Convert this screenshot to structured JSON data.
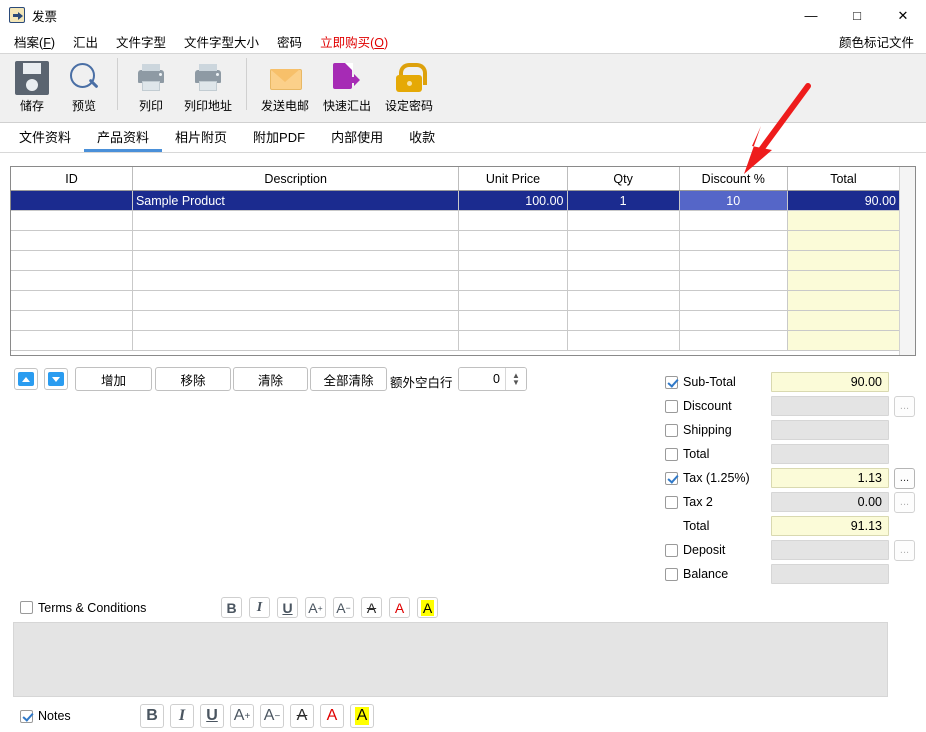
{
  "window": {
    "title": "发票",
    "icon": "invoice-icon",
    "minimize": "—",
    "maximize": "□",
    "close": "✕"
  },
  "menu": {
    "items": [
      {
        "label": "档案",
        "accel": "F",
        "name": "menu-file"
      },
      {
        "label": "汇出",
        "accel": "",
        "name": "menu-export"
      },
      {
        "label": "文件字型",
        "accel": "",
        "name": "menu-font"
      },
      {
        "label": "文件字型大小",
        "accel": "",
        "name": "menu-font-size"
      },
      {
        "label": "密码",
        "accel": "",
        "name": "menu-password"
      },
      {
        "label": "立即购买",
        "accel": "O",
        "name": "menu-buy-now"
      }
    ],
    "right_label": "颜色标记文件"
  },
  "toolbar": {
    "buttons": [
      {
        "label": "储存",
        "icon": "save-icon"
      },
      {
        "label": "预览",
        "icon": "preview-magnifier-icon"
      },
      {
        "label": "列印",
        "icon": "print-icon"
      },
      {
        "label": "列印地址",
        "icon": "print-address-icon"
      },
      {
        "label": "发送电邮",
        "icon": "email-icon"
      },
      {
        "label": "快速汇出",
        "icon": "quick-export-icon"
      },
      {
        "label": "设定密码",
        "icon": "lock-icon"
      }
    ]
  },
  "tabs": [
    {
      "label": "文件资料",
      "active": false
    },
    {
      "label": "产品资料",
      "active": true
    },
    {
      "label": "相片附页",
      "active": false
    },
    {
      "label": "附加PDF",
      "active": false
    },
    {
      "label": "内部使用",
      "active": false
    },
    {
      "label": "收款",
      "active": false
    }
  ],
  "grid": {
    "columns": [
      "ID",
      "Description",
      "Unit Price",
      "Qty",
      "Discount %",
      "Total"
    ],
    "rows": [
      {
        "id": "",
        "description": "Sample Product",
        "unit_price": "100.00",
        "qty": "1",
        "discount": "10",
        "total": "90.00",
        "selected": true,
        "selected_cell": "discount"
      }
    ],
    "empty_row_count": 7
  },
  "rowbar": {
    "move_up": "▲",
    "move_down": "▼",
    "add": "增加",
    "remove": "移除",
    "clear": "清除",
    "clear_all": "全部清除",
    "extra_blank_label": "额外空白行",
    "extra_blank_value": "0"
  },
  "totals": {
    "rows": [
      {
        "label": "Sub-Total",
        "checked": true,
        "value": "90.00",
        "yellow": true,
        "dots": "none"
      },
      {
        "label": "Discount",
        "checked": false,
        "value": "",
        "yellow": false,
        "dots": "disabled"
      },
      {
        "label": "Shipping",
        "checked": false,
        "value": "",
        "yellow": false,
        "dots": "none"
      },
      {
        "label": "Total",
        "checked": false,
        "value": "",
        "yellow": false,
        "dots": "none"
      },
      {
        "label": "Tax (1.25%)",
        "checked": true,
        "value": "1.13",
        "yellow": true,
        "dots": "enabled"
      },
      {
        "label": "Tax 2",
        "checked": false,
        "value": "0.00",
        "yellow": false,
        "dots": "disabled"
      },
      {
        "label": "Total",
        "checked": null,
        "value": "91.13",
        "yellow": true,
        "dots": "none"
      },
      {
        "label": "Deposit",
        "checked": false,
        "value": "",
        "yellow": false,
        "dots": "disabled"
      },
      {
        "label": "Balance",
        "checked": false,
        "value": "",
        "yellow": false,
        "dots": "none"
      }
    ],
    "dots_label": "..."
  },
  "terms": {
    "label": "Terms & Conditions",
    "checked": false,
    "content": ""
  },
  "notes": {
    "label": "Notes",
    "checked": true
  },
  "format_buttons": [
    {
      "glyph": "B",
      "name": "bold-button"
    },
    {
      "glyph": "I",
      "name": "italic-button"
    },
    {
      "glyph": "U",
      "name": "underline-button"
    },
    {
      "glyph": "A",
      "sup": "+",
      "name": "increase-font-size-button"
    },
    {
      "glyph": "A",
      "sup": "−",
      "name": "decrease-font-size-button"
    },
    {
      "glyph": "A",
      "name": "strikethrough-button"
    },
    {
      "glyph": "A",
      "name": "font-color-button"
    },
    {
      "glyph": "A",
      "name": "highlight-color-button"
    }
  ],
  "annotation": {
    "arrow": "red-arrow-pointing-to-discount-column",
    "color": "#ee1c1c"
  },
  "colors": {
    "selection_blue": "#1b2b8f",
    "cell_highlight": "#5566c8",
    "yellow_field": "#fbfbd8",
    "accent_tab": "#4a90d9",
    "buy_now_red": "#e00000"
  }
}
